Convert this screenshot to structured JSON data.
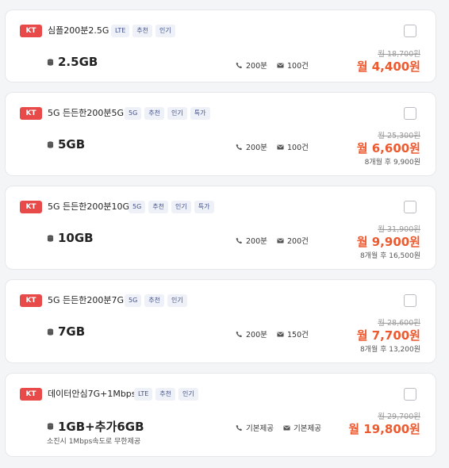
{
  "plans": [
    {
      "carrier": "KT",
      "name": "심플200분2.5G",
      "tags": [
        "LTE",
        "추천",
        "인기"
      ],
      "data": "2.5GB",
      "voice": "200분",
      "sms": "100건",
      "original_price": "월 18,700원",
      "price": "월 4,400원",
      "after_price": ""
    },
    {
      "carrier": "KT",
      "name": "5G 든든한200분5G",
      "tags": [
        "5G",
        "추천",
        "인기",
        "특가"
      ],
      "data": "5GB",
      "voice": "200분",
      "sms": "100건",
      "original_price": "월 25,300원",
      "price": "월 6,600원",
      "after_price": "8개월 후 9,900원"
    },
    {
      "carrier": "KT",
      "name": "5G 든든한200분10G",
      "tags": [
        "5G",
        "추천",
        "인기",
        "특가"
      ],
      "data": "10GB",
      "voice": "200분",
      "sms": "200건",
      "original_price": "월 31,900원",
      "price": "월 9,900원",
      "after_price": "8개월 후 16,500원"
    },
    {
      "carrier": "KT",
      "name": "5G 든든한200분7G",
      "tags": [
        "5G",
        "추천",
        "인기"
      ],
      "data": "7GB",
      "voice": "200분",
      "sms": "150건",
      "original_price": "월 28,600원",
      "price": "월 7,700원",
      "after_price": "8개월 후 13,200원"
    },
    {
      "carrier": "KT",
      "name": "데이터안심7G+1Mbps",
      "tags": [
        "LTE",
        "추천",
        "인기"
      ],
      "data": "1GB+추가6GB",
      "voice": "기본제공",
      "sms": "기본제공",
      "original_price": "월 29,700원",
      "price": "월 19,800원",
      "after_price": "",
      "note": "소진시 1Mbps속도로 무한제공"
    }
  ],
  "colors": {
    "carrier_badge": "#e84a4a",
    "price": "#ec5a30",
    "tag_bg": "#eef1f8",
    "tag_text": "#43518a"
  }
}
